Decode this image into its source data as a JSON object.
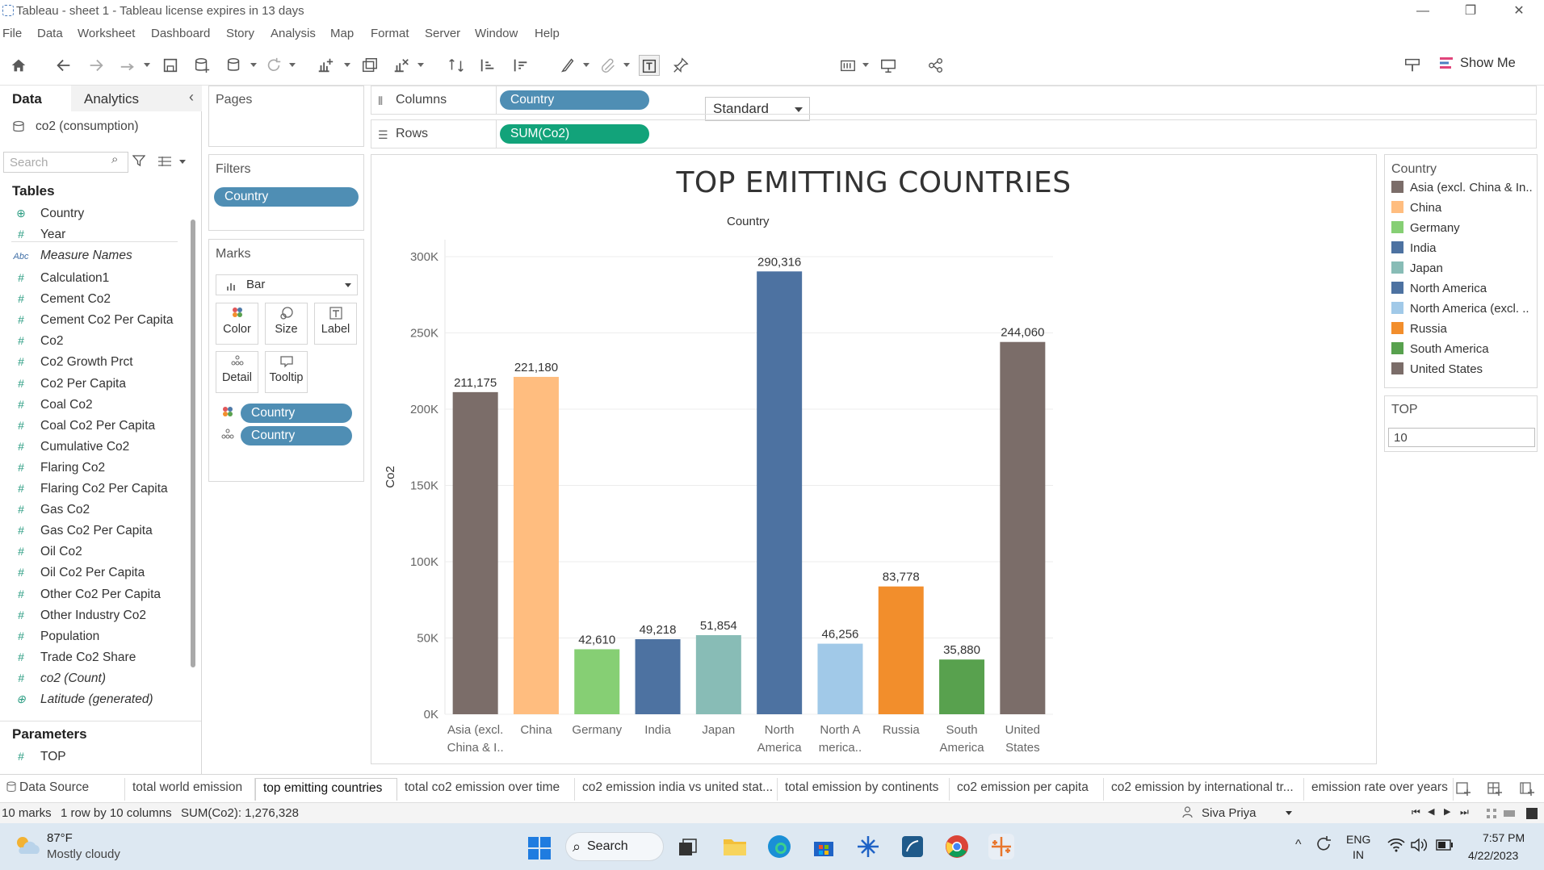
{
  "window": {
    "title": "Tableau - sheet 1 - Tableau license expires in 13 days",
    "minimize": "—",
    "restore": "❐",
    "close": "✕"
  },
  "menu": [
    "File",
    "Data",
    "Worksheet",
    "Dashboard",
    "Story",
    "Analysis",
    "Map",
    "Format",
    "Server",
    "Window",
    "Help"
  ],
  "toolbar": {
    "fit_select": "Standard",
    "show_me": "Show Me"
  },
  "data_pane": {
    "tab_data": "Data",
    "tab_analytics": "Analytics",
    "datasource": "co2 (consumption)",
    "search_placeholder": "Search",
    "tables_header": "Tables",
    "fields": [
      {
        "name": "Country",
        "type": "globe"
      },
      {
        "name": "Year",
        "type": "num"
      },
      {
        "name": "Measure Names",
        "type": "abc"
      },
      {
        "name": "Calculation1",
        "type": "num"
      },
      {
        "name": "Cement Co2",
        "type": "num"
      },
      {
        "name": "Cement Co2 Per Capita",
        "type": "num"
      },
      {
        "name": "Co2",
        "type": "num"
      },
      {
        "name": "Co2 Growth Prct",
        "type": "num"
      },
      {
        "name": "Co2 Per Capita",
        "type": "num"
      },
      {
        "name": "Coal Co2",
        "type": "num"
      },
      {
        "name": "Coal Co2 Per Capita",
        "type": "num"
      },
      {
        "name": "Cumulative Co2",
        "type": "num"
      },
      {
        "name": "Flaring Co2",
        "type": "num"
      },
      {
        "name": "Flaring Co2 Per Capita",
        "type": "num"
      },
      {
        "name": "Gas Co2",
        "type": "num"
      },
      {
        "name": "Gas Co2 Per Capita",
        "type": "num"
      },
      {
        "name": "Oil Co2",
        "type": "num"
      },
      {
        "name": "Oil Co2 Per Capita",
        "type": "num"
      },
      {
        "name": "Other Co2 Per Capita",
        "type": "num"
      },
      {
        "name": "Other Industry Co2",
        "type": "num"
      },
      {
        "name": "Population",
        "type": "num"
      },
      {
        "name": "Trade Co2 Share",
        "type": "num"
      },
      {
        "name": "co2 (Count)",
        "type": "num"
      },
      {
        "name": "Latitude (generated)",
        "type": "globe"
      }
    ],
    "parameters_header": "Parameters",
    "parameters": [
      {
        "name": "TOP",
        "type": "num"
      }
    ]
  },
  "shelves": {
    "pages": "Pages",
    "filters": "Filters",
    "filter_pill": "Country",
    "marks": "Marks",
    "mark_type": "Bar",
    "mark_buttons": [
      "Color",
      "Size",
      "Label",
      "Detail",
      "Tooltip"
    ],
    "mark_pills": [
      "Country",
      "Country"
    ],
    "columns_label": "Columns",
    "columns_pill": "Country",
    "rows_label": "Rows",
    "rows_pill": "SUM(Co2)"
  },
  "legend": {
    "title": "Country",
    "items": [
      {
        "label": "Asia (excl. China & In..",
        "color": "#7b6d69"
      },
      {
        "label": "China",
        "color": "#ffbd7f"
      },
      {
        "label": "Germany",
        "color": "#86cf74"
      },
      {
        "label": "India",
        "color": "#4d72a1"
      },
      {
        "label": "Japan",
        "color": "#88bcb6"
      },
      {
        "label": "North America",
        "color": "#4d72a1"
      },
      {
        "label": "North America (excl. ..",
        "color": "#a1c9e8"
      },
      {
        "label": "Russia",
        "color": "#f28e2c"
      },
      {
        "label": "South America",
        "color": "#58a14e"
      },
      {
        "label": "United States",
        "color": "#7b6d69"
      }
    ]
  },
  "top_param": {
    "title": "TOP",
    "value": "10"
  },
  "chart_data": {
    "type": "bar",
    "title": "TOP EMITTING COUNTRIES",
    "header": "Country",
    "ylabel": "Co2",
    "ylim": [
      0,
      300000
    ],
    "yticks": [
      "0K",
      "50K",
      "100K",
      "150K",
      "200K",
      "250K",
      "300K"
    ],
    "categories": [
      [
        "Asia (excl.",
        "China & I.."
      ],
      [
        "China"
      ],
      [
        "Germany"
      ],
      [
        "India"
      ],
      [
        "Japan"
      ],
      [
        "North",
        "America"
      ],
      [
        "North A",
        "merica.."
      ],
      [
        "Russia"
      ],
      [
        "South",
        "America"
      ],
      [
        "United",
        "States"
      ]
    ],
    "values": [
      211175,
      221180,
      42610,
      49218,
      51854,
      290316,
      46256,
      83778,
      35880,
      244060
    ],
    "labels": [
      "211,175",
      "221,180",
      "42,610",
      "49,218",
      "51,854",
      "290,316",
      "46,256",
      "83,778",
      "35,880",
      "244,060"
    ],
    "colors": [
      "#7b6d69",
      "#ffbd7f",
      "#86cf74",
      "#4d72a1",
      "#88bcb6",
      "#4d72a1",
      "#a1c9e8",
      "#f28e2c",
      "#58a14e",
      "#7b6d69"
    ]
  },
  "sheet_tabs": {
    "data_source": "Data Source",
    "tabs": [
      "total world emission",
      "top emitting countries",
      "total co2 emission over time",
      "co2 emission india vs united stat...",
      "total emission by continents",
      "co2 emission per capita",
      "co2 emission by international tr...",
      "emission rate over years"
    ],
    "active": "top emitting countries"
  },
  "status": {
    "marks": "10 marks",
    "rows_cols": "1 row by 10 columns",
    "sum": "SUM(Co2): 1,276,328",
    "user": "Siva Priya"
  },
  "taskbar": {
    "temp": "87°F",
    "weather": "Mostly cloudy",
    "search": "Search",
    "lang1": "ENG",
    "lang2": "IN",
    "time": "7:57 PM",
    "date": "4/22/2023"
  }
}
